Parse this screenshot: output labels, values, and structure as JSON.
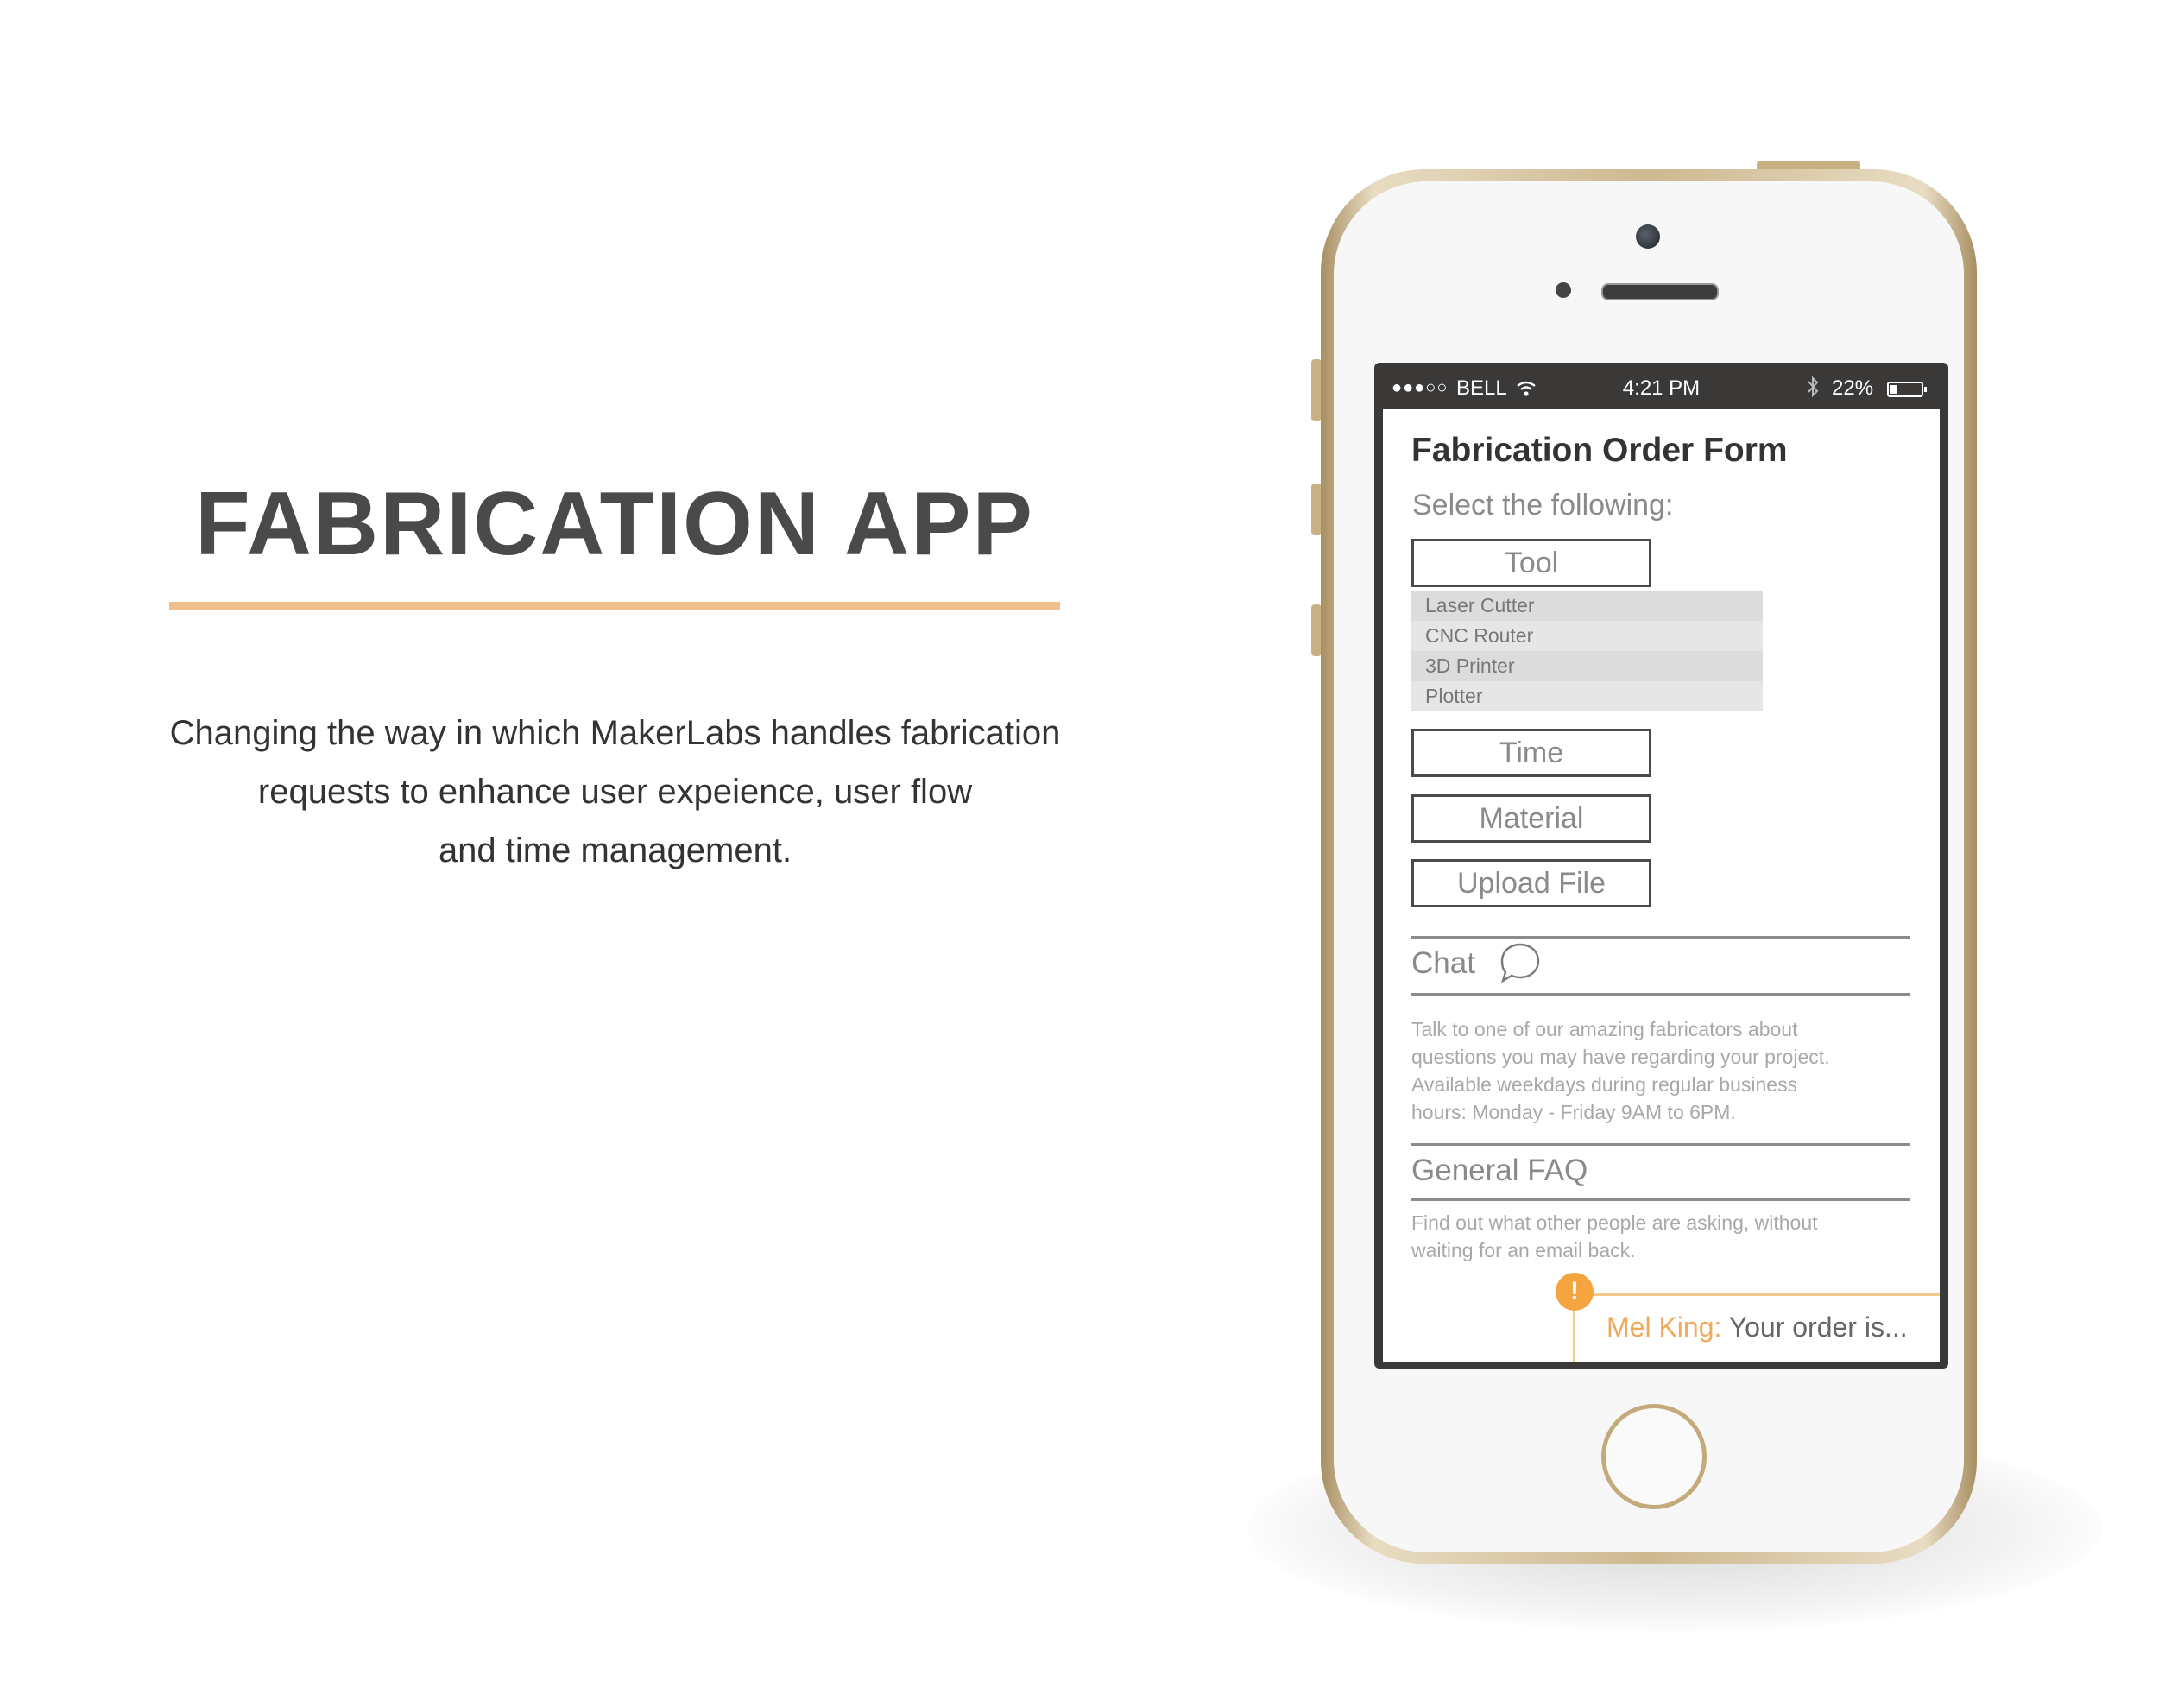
{
  "hero": {
    "title": "FABRICATION APP",
    "description_lines": [
      "Changing the way in which MakerLabs handles fabrication",
      "requests to enhance user expeience, user flow",
      "and time management."
    ]
  },
  "colors": {
    "accent_rule": "#f0bf8c",
    "title_text": "#4a4a4a",
    "notification_accent": "#f4a540",
    "phone_frame": "#c9b184"
  },
  "status_bar": {
    "signal": "●●●○○",
    "carrier": "BELL",
    "time": "4:21 PM",
    "battery": "22%",
    "battery_level": 0.22,
    "icons": [
      "wifi-icon",
      "bluetooth-icon",
      "battery-icon"
    ]
  },
  "form": {
    "title": "Fabrication Order Form",
    "instruction": "Select the following:",
    "tool_label": "Tool",
    "tool_options": [
      "Laser Cutter",
      "CNC Router",
      "3D Printer",
      "Plotter"
    ],
    "time_label": "Time",
    "material_label": "Material",
    "upload_label": "Upload File"
  },
  "chat": {
    "title": "Chat",
    "icon": "chat-bubble-icon",
    "description_lines": [
      "Talk to one of our amazing fabricators about",
      "questions you may have regarding your project.",
      "Available weekdays during regular business",
      "hours: Monday - Friday 9AM to 6PM."
    ]
  },
  "faq": {
    "title": "General FAQ",
    "description_lines": [
      "Find out what other people are asking, without",
      "waiting for an email back."
    ]
  },
  "notification": {
    "badge": "!",
    "sender": "Mel King:",
    "message": " Your order is..."
  }
}
